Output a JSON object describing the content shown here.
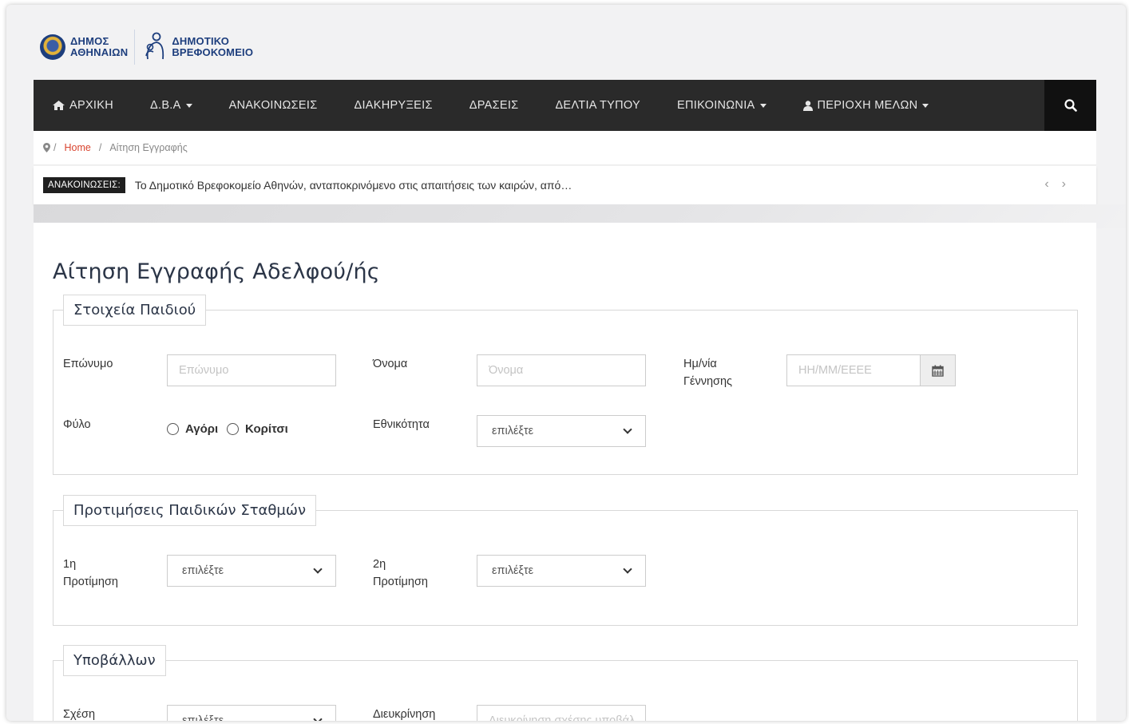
{
  "logo": {
    "municipality_line1": "ΔΗΜΟΣ",
    "municipality_line2": "ΑΘΗΝΑΙΩΝ",
    "org_line1": "ΔΗΜΟΤΙΚΟ",
    "org_line2": "ΒΡΕΦΟΚΟΜΕΙΟ"
  },
  "nav": {
    "items": [
      "ΑΡΧΙΚΗ",
      "Δ.Β.Α",
      "ΑΝΑΚΟΙΝΩΣΕΙΣ",
      "ΔΙΑΚΗΡΥΞΕΙΣ",
      "ΔΡΑΣΕΙΣ",
      "ΔΕΛΤΙΑ ΤΥΠΟΥ",
      "ΕΠΙΚΟΙΝΩΝΙΑ",
      "ΠΕΡΙΟΧΗ ΜΕΛΩΝ"
    ]
  },
  "breadcrumb": {
    "home": "Home",
    "current": "Αίτηση Εγγραφής"
  },
  "ticker": {
    "label": "ΑΝΑΚΟΙΝΩΣΕΙΣ:",
    "text": "Το Δημοτικό Βρεφοκομείο Αθηνών, ανταποκρινόμενο στις απαιτήσεις των καιρών, από…"
  },
  "page": {
    "title": "Αίτηση Εγγραφής Αδελφού/ής"
  },
  "child": {
    "legend": "Στοιχεία Παιδιού",
    "surname_label": "Επώνυμο",
    "surname_placeholder": "Επώνυμο",
    "name_label": "Όνομα",
    "name_placeholder": "Όνομα",
    "dob_label_1": "Ημ/νία",
    "dob_label_2": "Γέννησης",
    "dob_placeholder": "ΗΗ/ΜΜ/ΕΕΕΕ",
    "gender_label": "Φύλο",
    "gender_boy": "Αγόρι",
    "gender_girl": "Κορίτσι",
    "nationality_label": "Εθνικότητα",
    "nationality_value": "επιλέξτε"
  },
  "prefs": {
    "legend": "Προτιμήσεις Παιδικών Σταθμών",
    "first_label_1": "1η",
    "first_label_2": "Προτίμηση",
    "first_value": "επιλέξτε",
    "second_label_1": "2η",
    "second_label_2": "Προτίμηση",
    "second_value": "επιλέξτε"
  },
  "submitter": {
    "legend": "Υποβάλλων",
    "relation_label": "Σχέση",
    "relation_value": "επιλέξτε",
    "clarify_label": "Διευκρίνηση",
    "clarify_placeholder": "Διευκρίνηση σχέσης υποβάλ"
  }
}
